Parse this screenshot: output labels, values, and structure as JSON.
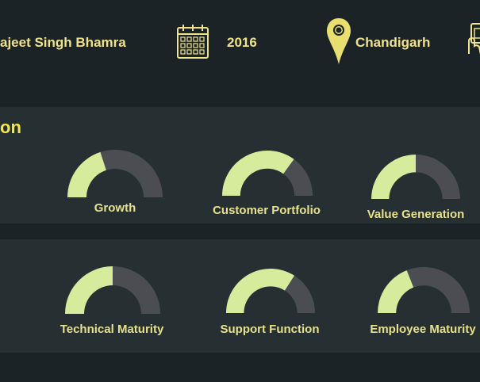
{
  "header": {
    "name": "ajeet Singh Bhamra",
    "year": "2016",
    "location": "Chandigarh",
    "icons": {
      "calendar": "calendar-icon",
      "location": "location-pin-icon",
      "touch": "touch-device-icon"
    }
  },
  "colors": {
    "background": "#1b2326",
    "panel": "#263033",
    "gauge_fill": "#d6eb9b",
    "gauge_track": "#4b4d52",
    "label": "#e7e08c",
    "title": "#f4e845"
  },
  "panels": [
    {
      "title": "on",
      "gauges": [
        {
          "label": "Growth",
          "value": 0.4
        },
        {
          "label": "Customer Portfolio",
          "value": 0.7
        },
        {
          "label": "Value Generation",
          "value": 0.5
        }
      ]
    },
    {
      "title": "",
      "gauges": [
        {
          "label": "Technical Maturity",
          "value": 0.5
        },
        {
          "label": "Support Function",
          "value": 0.68
        },
        {
          "label": "Employee Maturity",
          "value": 0.38
        }
      ]
    }
  ]
}
